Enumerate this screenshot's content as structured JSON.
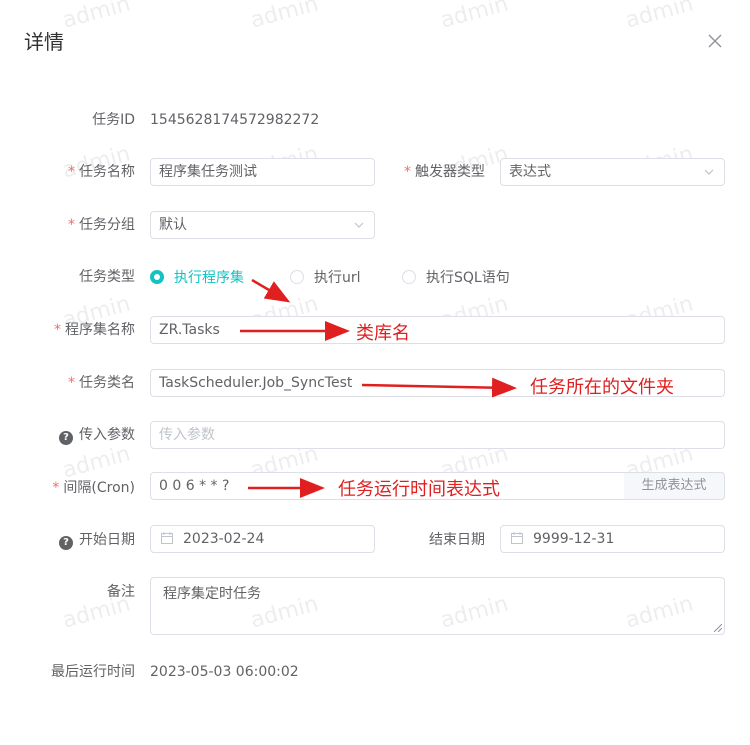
{
  "dialog": {
    "title": "详情"
  },
  "form": {
    "task_id": {
      "label": "任务ID",
      "value": "1545628174572982272"
    },
    "task_name": {
      "label": "任务名称",
      "value": "程序集任务测试"
    },
    "trigger_type": {
      "label": "触发器类型",
      "value": "表达式"
    },
    "task_group": {
      "label": "任务分组",
      "value": "默认"
    },
    "task_type": {
      "label": "任务类型",
      "options": [
        "执行程序集",
        "执行url",
        "执行SQL语句"
      ],
      "selected": "执行程序集"
    },
    "assembly_name": {
      "label": "程序集名称",
      "value": "ZR.Tasks"
    },
    "class_name": {
      "label": "任务类名",
      "value": "TaskScheduler.Job_SyncTest"
    },
    "params": {
      "label": "传入参数",
      "placeholder": "传入参数"
    },
    "interval": {
      "label": "间隔(Cron)",
      "value": "0 0 6 * * ?",
      "button": "生成表达式"
    },
    "start_date": {
      "label": "开始日期",
      "value": "2023-02-24"
    },
    "end_date": {
      "label": "结束日期",
      "value": "9999-12-31"
    },
    "remark": {
      "label": "备注",
      "value": "程序集定时任务"
    },
    "last_run": {
      "label": "最后运行时间",
      "value": "2023-05-03 06:00:02"
    }
  },
  "annotations": {
    "class_library": "类库名",
    "task_folder": "任务所在的文件夹",
    "cron_expression": "任务运行时间表达式"
  },
  "watermark": "admin",
  "colors": {
    "accent": "#13c2c2",
    "required": "#f56c6c",
    "annotation": "#e02020"
  }
}
